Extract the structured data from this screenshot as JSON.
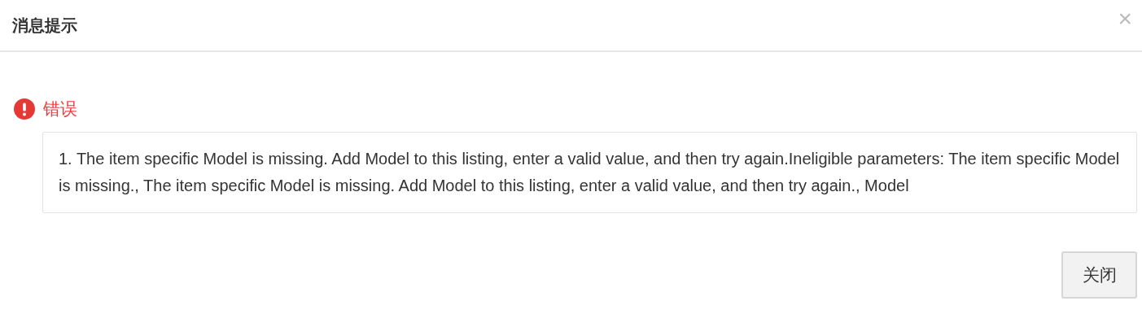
{
  "dialog": {
    "title": "消息提示",
    "close_symbol": "×"
  },
  "error": {
    "label": "错误",
    "message": "1. The item specific Model is missing. Add Model to this listing, enter a valid value, and then try again.Ineligible parameters: The item specific Model is missing., The item specific Model is missing. Add Model to this listing, enter a valid value, and then try again., Model"
  },
  "buttons": [
    {
      "label": "关闭"
    }
  ]
}
